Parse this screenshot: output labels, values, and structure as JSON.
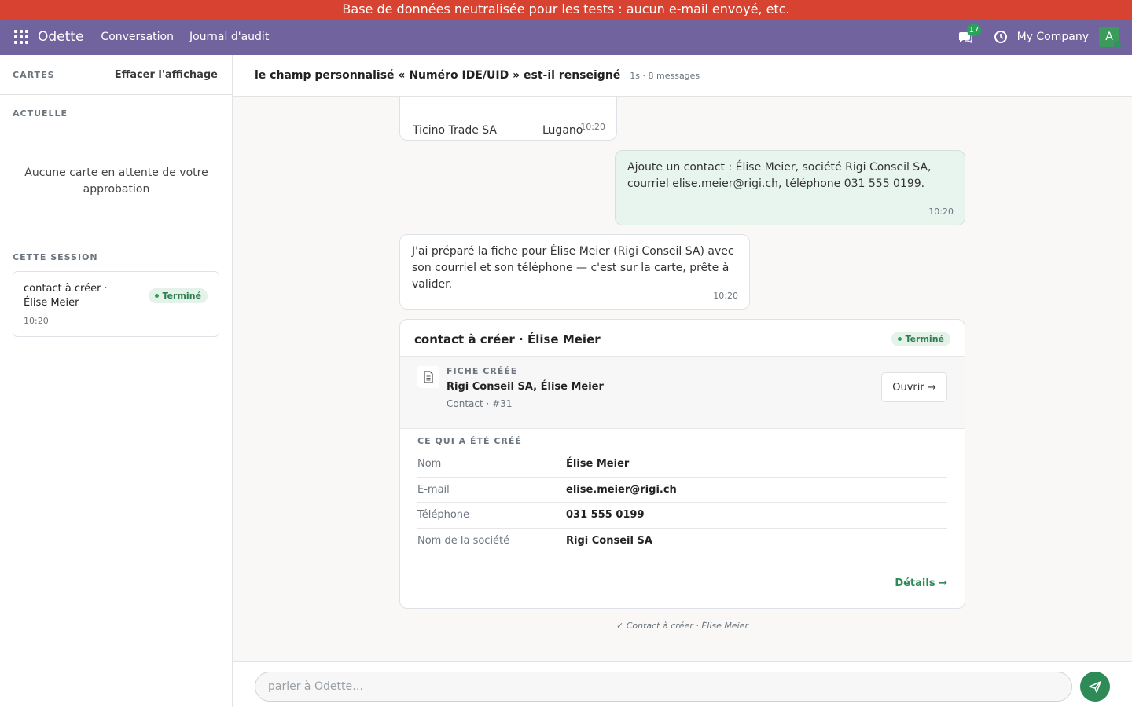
{
  "banner": {
    "text": "Base de données neutralisée pour les tests : aucun e-mail envoyé, etc."
  },
  "navbar": {
    "brand": "Odette",
    "links": [
      "Conversation",
      "Journal d'audit"
    ],
    "messages_count": "17",
    "company": "My Company",
    "avatar_initial": "A"
  },
  "sidebar": {
    "cards_title": "CARTES",
    "clear_label": "Effacer l'affichage",
    "current_title": "ACTUELLE",
    "empty_message": "Aucune carte en attente de votre approbation",
    "session_title": "CETTE SESSION",
    "session_card": {
      "title": "contact à créer · Élise Meier",
      "time": "10:20",
      "status": "Terminé"
    }
  },
  "conversation": {
    "title": "le champ personnalisé « Numéro IDE/UID » est-il renseigné",
    "meta": "1s · 8 messages",
    "top_bubble": {
      "col1": "Ticino Trade SA",
      "col2": "Lugano",
      "time": "10:20"
    },
    "user_message": {
      "text": "Ajoute un contact : Élise Meier, société Rigi Conseil SA, courriel elise.meier@rigi.ch, téléphone 031 555 0199.",
      "time": "10:20"
    },
    "bot_message": {
      "text": "J'ai préparé la fiche pour Élise Meier (Rigi Conseil SA) avec son courriel et son téléphone — c'est sur la carte, prête à valider.",
      "time": "10:20"
    },
    "result_card": {
      "title": "contact à créer · Élise Meier",
      "status": "Terminé",
      "record_label": "FICHE CRÉÉE",
      "record_name": "Rigi Conseil SA, Élise Meier",
      "record_sub": "Contact · #31",
      "open_label": "Ouvrir →",
      "created_title": "CE QUI A ÉTÉ CRÉÉ",
      "fields": [
        {
          "label": "Nom",
          "value": "Élise Meier"
        },
        {
          "label": "E-mail",
          "value": "elise.meier@rigi.ch"
        },
        {
          "label": "Téléphone",
          "value": "031 555 0199"
        },
        {
          "label": "Nom de la société",
          "value": "Rigi Conseil SA"
        }
      ],
      "details_label": "Détails →"
    },
    "trace": "✓ Contact à créer · Élise Meier"
  },
  "composer": {
    "placeholder": "parler à Odette…"
  },
  "colors": {
    "banner": "#d74330",
    "navbar": "#71639e",
    "accent": "#2e8b57",
    "user_bubble": "#e8f4ee",
    "status_bg": "#e4f2e9"
  }
}
